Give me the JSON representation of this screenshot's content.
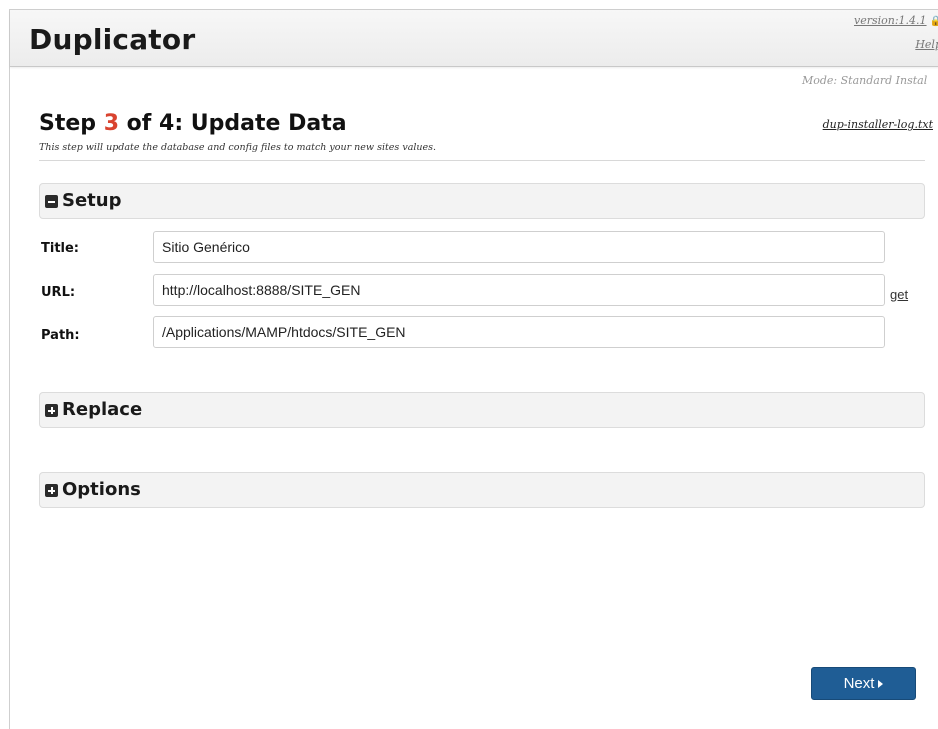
{
  "header": {
    "app_title": "Duplicator",
    "version": "version:1.4.1",
    "help": "Help",
    "mode": "Mode: Standard Instal"
  },
  "step": {
    "prefix": "Step ",
    "number": "3",
    "suffix": " of 4: Update Data",
    "description": "This step will update the database and config files to match your new sites values.",
    "log_link": "dup-installer-log.txt"
  },
  "sections": {
    "setup": {
      "label": "Setup",
      "state": "expanded"
    },
    "replace": {
      "label": "Replace",
      "state": "collapsed"
    },
    "options": {
      "label": "Options",
      "state": "collapsed"
    }
  },
  "fields": {
    "title": {
      "label": "Title:",
      "value": "Sitio Genérico"
    },
    "url": {
      "label": "URL:",
      "value": "http://localhost:8888/SITE_GEN",
      "get_link": "get"
    },
    "path": {
      "label": "Path:",
      "value": "/Applications/MAMP/htdocs/SITE_GEN"
    }
  },
  "footer": {
    "next_label": "Next"
  },
  "colors": {
    "step_number": "#d9432f",
    "primary_button": "#1f5d95"
  },
  "icons": {
    "setup": "minus-box-icon",
    "replace": "plus-box-icon",
    "options": "plus-box-icon",
    "next": "play-icon",
    "version": "lock-icon"
  }
}
